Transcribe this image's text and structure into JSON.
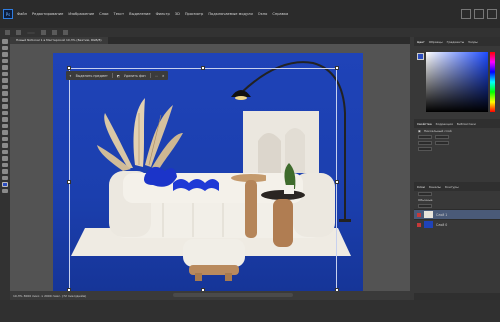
{
  "menubar": {
    "logo": "Ps",
    "items": [
      "Файл",
      "Редактирование",
      "Изображение",
      "Слои",
      "Текст",
      "Выделение",
      "Фильтр",
      "3D",
      "Просмотр",
      "Подключаемые модули",
      "Окно",
      "Справка"
    ]
  },
  "document_tab": "Новый Notional 1 в Мастерской 10,3% (Безтим, RGB/8)",
  "context_bar": {
    "select_label": "Выделить предмет",
    "remove_bg_label": "Удалить фон"
  },
  "panels": {
    "color_tabs": [
      "Цвет",
      "Образцы",
      "Градиенты",
      "Узоры"
    ],
    "properties_tabs": [
      "Свойства",
      "Коррекция",
      "Библиотеки"
    ],
    "properties_title": "Пиксельный слой",
    "layers_tabs": [
      "Слои",
      "Каналы",
      "Контуры"
    ],
    "layers_mode": "Обычные",
    "layer_names": [
      "Слой 1",
      "Слой 0"
    ]
  },
  "statusbar": {
    "text": "10,3%   3000 пикс. х 2000 пикс. (72 пикс/дюйм)"
  },
  "colors": {
    "background_blue": "#1f43b8",
    "ui_dark": "#2b2b2b",
    "ui_panel": "#383838",
    "accent_selection": "#4a5a78"
  }
}
